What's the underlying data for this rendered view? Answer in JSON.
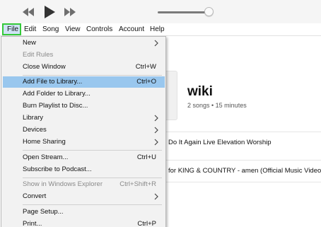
{
  "toolbar": {
    "rewind_icon": "rewind-icon",
    "play_icon": "play-icon",
    "forward_icon": "fast-forward-icon",
    "volume_level": 0.88
  },
  "menubar": {
    "items": [
      "File",
      "Edit",
      "Song",
      "View",
      "Controls",
      "Account",
      "Help"
    ]
  },
  "file_menu": {
    "items": [
      {
        "label": "New",
        "shortcut": "",
        "submenu": true,
        "disabled": false
      },
      {
        "label": "Edit Rules",
        "shortcut": "",
        "submenu": false,
        "disabled": true
      },
      {
        "label": "Close Window",
        "shortcut": "Ctrl+W",
        "submenu": false,
        "disabled": false
      },
      {
        "label": "Add File to Library...",
        "shortcut": "Ctrl+O",
        "submenu": false,
        "disabled": false,
        "highlighted": true
      },
      {
        "label": "Add Folder to Library...",
        "shortcut": "",
        "submenu": false,
        "disabled": false
      },
      {
        "label": "Burn Playlist to Disc...",
        "shortcut": "",
        "submenu": false,
        "disabled": false
      },
      {
        "label": "Library",
        "shortcut": "",
        "submenu": true,
        "disabled": false
      },
      {
        "label": "Devices",
        "shortcut": "",
        "submenu": true,
        "disabled": false
      },
      {
        "label": "Home Sharing",
        "shortcut": "",
        "submenu": true,
        "disabled": false
      },
      {
        "label": "Open Stream...",
        "shortcut": "Ctrl+U",
        "submenu": false,
        "disabled": false
      },
      {
        "label": "Subscribe to Podcast...",
        "shortcut": "",
        "submenu": false,
        "disabled": false
      },
      {
        "label": "Show in Windows Explorer",
        "shortcut": "Ctrl+Shift+R",
        "submenu": false,
        "disabled": true
      },
      {
        "label": "Convert",
        "shortcut": "",
        "submenu": true,
        "disabled": false
      },
      {
        "label": "Page Setup...",
        "shortcut": "",
        "submenu": false,
        "disabled": false
      },
      {
        "label": "Print...",
        "shortcut": "Ctrl+P",
        "submenu": false,
        "disabled": false
      }
    ]
  },
  "playlist": {
    "title": "wiki",
    "meta": "2 songs • 15 minutes",
    "tracks": [
      "Do It Again Live Elevation Worship",
      "for KING & COUNTRY - amen (Official Music Video)"
    ]
  },
  "colors": {
    "highlight": "#99c7ee",
    "file_outline": "#35c93a"
  }
}
